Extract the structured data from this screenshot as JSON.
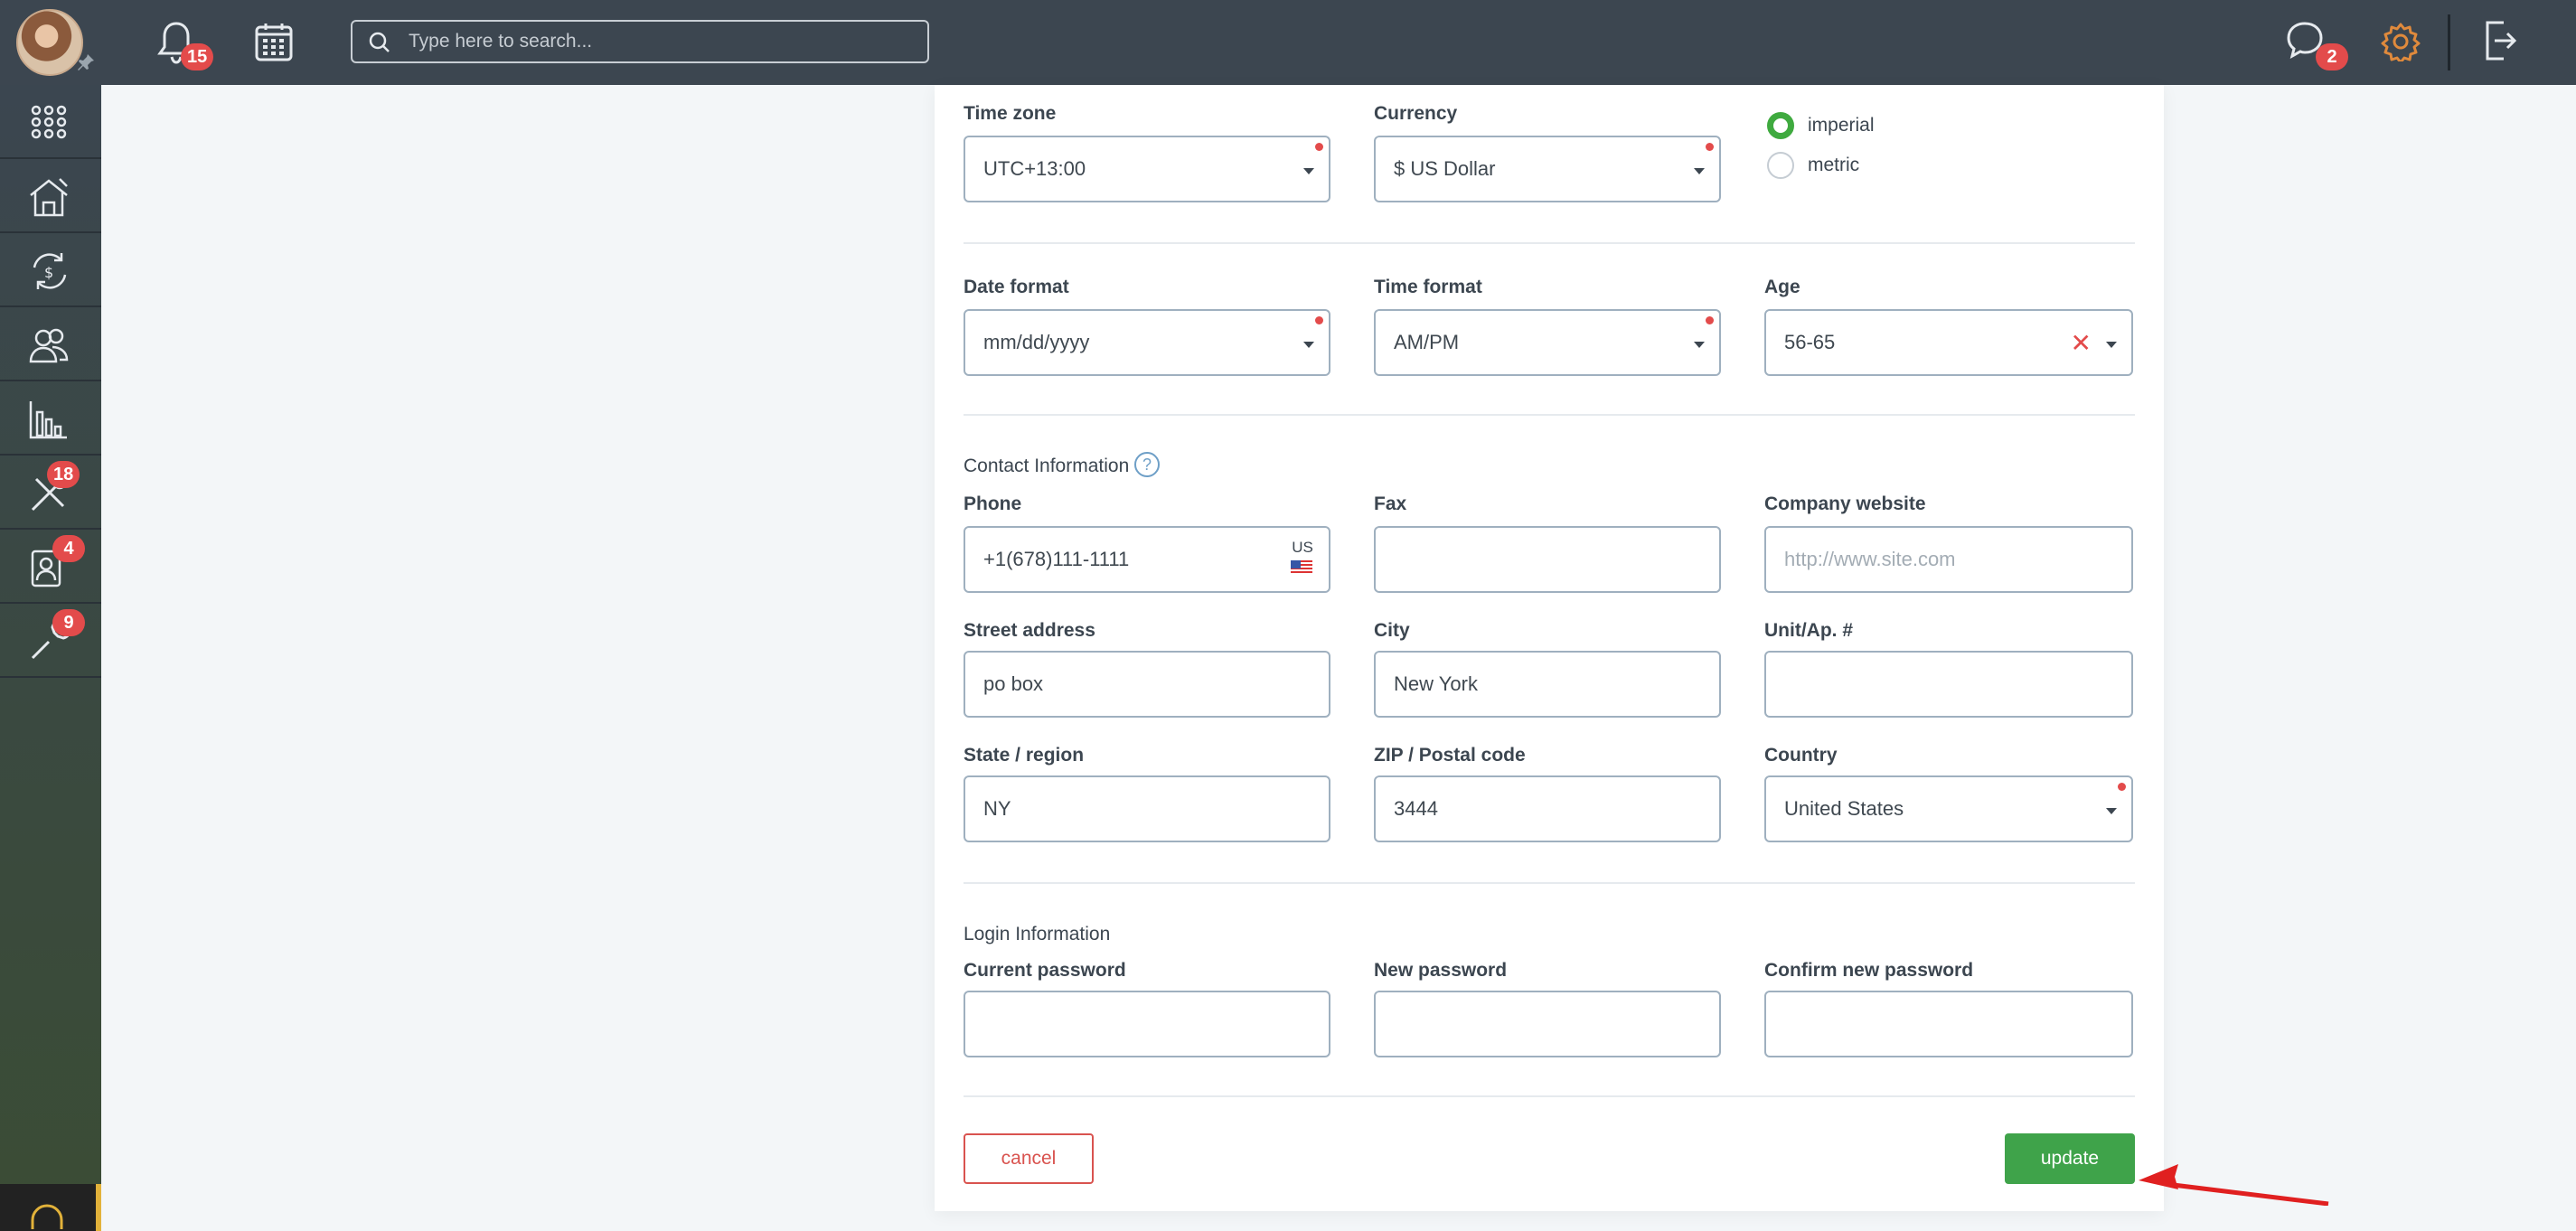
{
  "topbar": {
    "notifications_count": "15",
    "search_placeholder": "Type here to search...",
    "messages_count": "2"
  },
  "sidebar": {
    "items": [
      {
        "icon": "apps-grid-icon"
      },
      {
        "icon": "house-icon"
      },
      {
        "icon": "money-cycle-icon"
      },
      {
        "icon": "users-icon"
      },
      {
        "icon": "bar-chart-icon"
      },
      {
        "icon": "tools-icon",
        "badge": "18"
      },
      {
        "icon": "contact-card-icon",
        "badge": "4"
      },
      {
        "icon": "wrench-icon",
        "badge": "9"
      }
    ]
  },
  "form": {
    "timezone": {
      "label": "Time zone",
      "value": "UTC+13:00"
    },
    "currency": {
      "label": "Currency",
      "value": "$ US Dollar"
    },
    "units": {
      "imperial": "imperial",
      "metric": "metric",
      "selected": "imperial"
    },
    "date_format": {
      "label": "Date format",
      "value": "mm/dd/yyyy"
    },
    "time_format": {
      "label": "Time format",
      "value": "AM/PM"
    },
    "age": {
      "label": "Age",
      "value": "56-65"
    },
    "contact_heading": "Contact Information",
    "help_glyph": "?",
    "phone": {
      "label": "Phone",
      "value": "+1(678)111-1111",
      "country_code": "US"
    },
    "fax": {
      "label": "Fax",
      "value": ""
    },
    "website": {
      "label": "Company website",
      "placeholder": "http://www.site.com"
    },
    "street": {
      "label": "Street address",
      "value": "po box"
    },
    "city": {
      "label": "City",
      "value": "New York"
    },
    "unit": {
      "label": "Unit/Ap. #",
      "value": ""
    },
    "state": {
      "label": "State / region",
      "value": "NY"
    },
    "zip": {
      "label": "ZIP / Postal code",
      "value": "3444"
    },
    "country": {
      "label": "Country",
      "value": "United States"
    },
    "login_heading": "Login Information",
    "current_password": {
      "label": "Current password"
    },
    "new_password": {
      "label": "New password"
    },
    "confirm_password": {
      "label": "Confirm new password"
    },
    "cancel_label": "cancel",
    "update_label": "update"
  },
  "colors": {
    "accent_green": "#3fa34a",
    "danger_red": "#d9534f",
    "topbar": "#3c4650"
  }
}
